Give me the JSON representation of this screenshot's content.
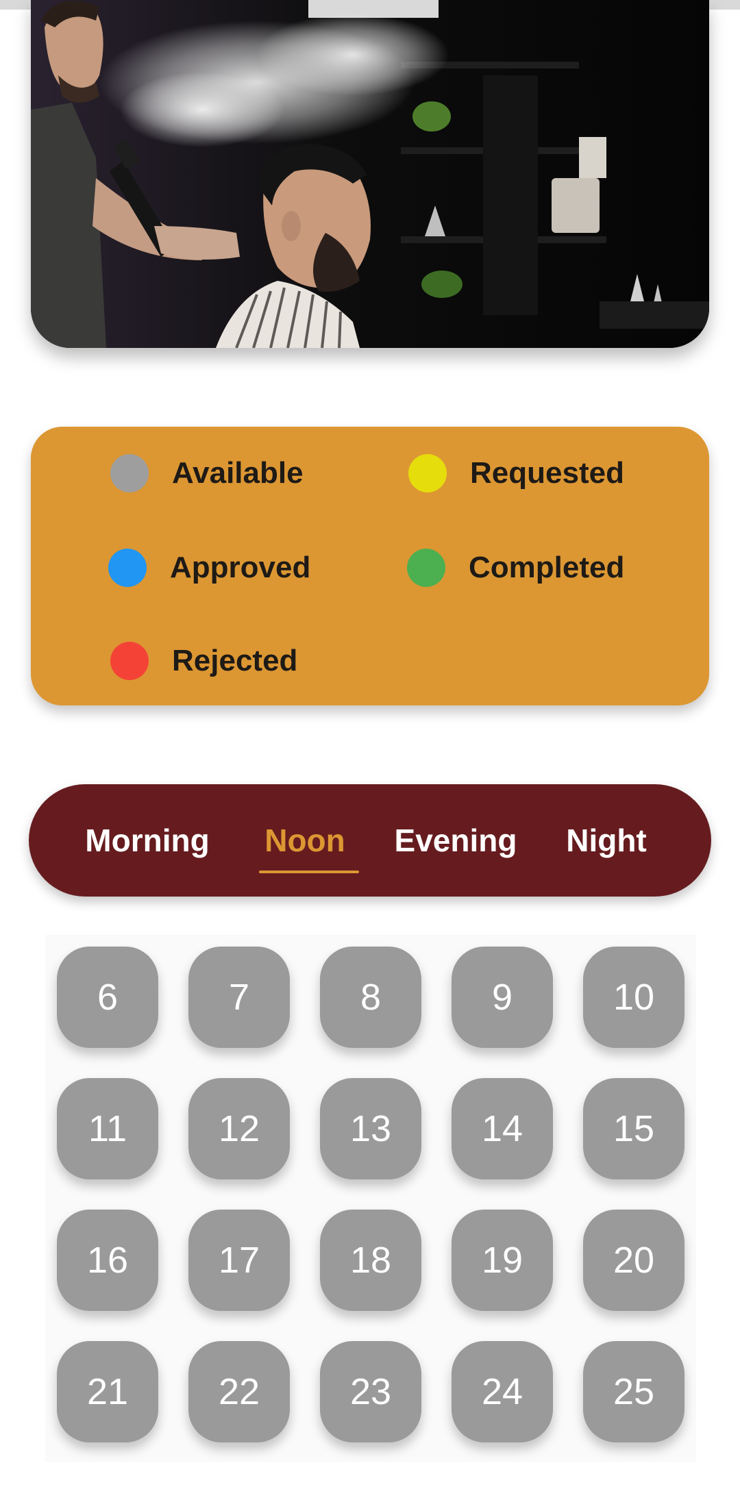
{
  "legend": [
    {
      "label": "Available",
      "color": "#9e9e9e"
    },
    {
      "label": "Requested",
      "color": "#e6dd0c"
    },
    {
      "label": "Approved",
      "color": "#2196f3"
    },
    {
      "label": "Completed",
      "color": "#4caf50"
    },
    {
      "label": "Rejected",
      "color": "#f44336"
    }
  ],
  "tabs": {
    "items": [
      "Morning",
      "Noon",
      "Evening",
      "Night"
    ],
    "active": "Noon"
  },
  "hours": [
    "6",
    "7",
    "8",
    "9",
    "10",
    "11",
    "12",
    "13",
    "14",
    "15",
    "16",
    "17",
    "18",
    "19",
    "20",
    "21",
    "22",
    "23",
    "24",
    "25"
  ],
  "colors": {
    "accent": "#dc9733",
    "tab_bar": "#661c1f",
    "slot_available": "#9a9a9a"
  }
}
